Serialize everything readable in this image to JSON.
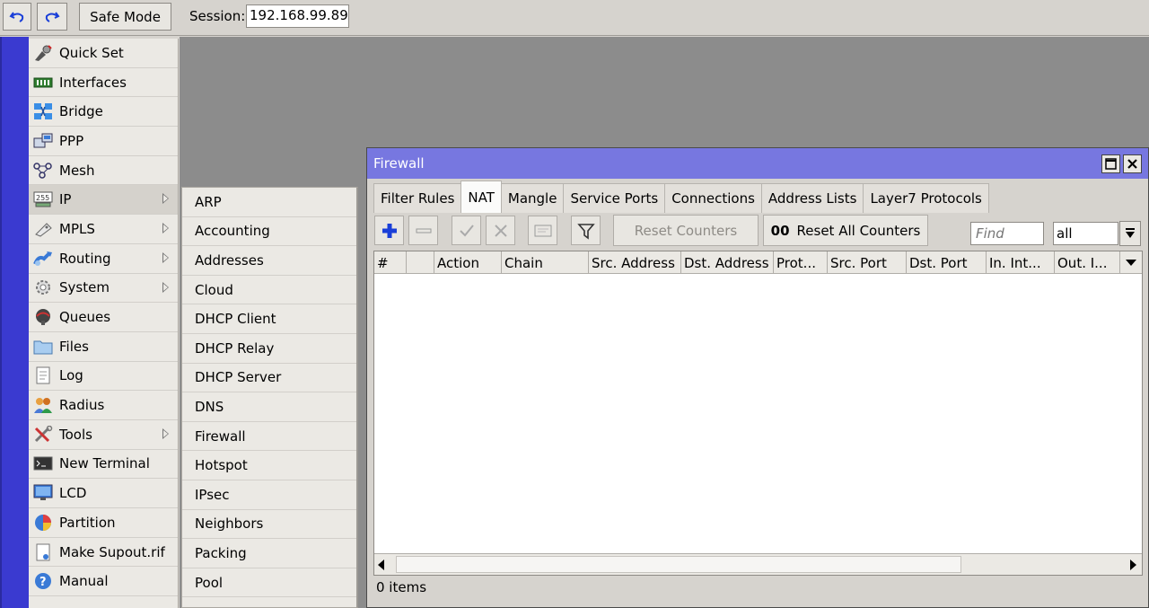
{
  "toolbar": {
    "safe_mode_label": "Safe Mode",
    "session_label": "Session:",
    "session_value": "192.168.99.89"
  },
  "main_menu": {
    "items": [
      {
        "label": "Quick Set",
        "icon": "quick-set-icon"
      },
      {
        "label": "Interfaces",
        "icon": "interfaces-icon"
      },
      {
        "label": "Bridge",
        "icon": "bridge-icon"
      },
      {
        "label": "PPP",
        "icon": "ppp-icon"
      },
      {
        "label": "Mesh",
        "icon": "mesh-icon"
      },
      {
        "label": "IP",
        "icon": "ip-icon"
      },
      {
        "label": "MPLS",
        "icon": "mpls-icon"
      },
      {
        "label": "Routing",
        "icon": "routing-icon"
      },
      {
        "label": "System",
        "icon": "system-icon"
      },
      {
        "label": "Queues",
        "icon": "queues-icon"
      },
      {
        "label": "Files",
        "icon": "files-icon"
      },
      {
        "label": "Log",
        "icon": "log-icon"
      },
      {
        "label": "Radius",
        "icon": "radius-icon"
      },
      {
        "label": "Tools",
        "icon": "tools-icon"
      },
      {
        "label": "New Terminal",
        "icon": "terminal-icon"
      },
      {
        "label": "LCD",
        "icon": "lcd-icon"
      },
      {
        "label": "Partition",
        "icon": "partition-icon"
      },
      {
        "label": "Make Supout.rif",
        "icon": "supout-icon"
      },
      {
        "label": "Manual",
        "icon": "manual-icon"
      }
    ]
  },
  "ip_submenu": {
    "items": [
      "ARP",
      "Accounting",
      "Addresses",
      "Cloud",
      "DHCP Client",
      "DHCP Relay",
      "DHCP Server",
      "DNS",
      "Firewall",
      "Hotspot",
      "IPsec",
      "Neighbors",
      "Packing",
      "Pool"
    ]
  },
  "firewall": {
    "title": "Firewall",
    "tabs": [
      "Filter Rules",
      "NAT",
      "Mangle",
      "Service Ports",
      "Connections",
      "Address Lists",
      "Layer7 Protocols"
    ],
    "active_tab": "NAT",
    "reset_counters_label": "Reset Counters",
    "reset_all_counters_prefix": "00",
    "reset_all_counters_label": "Reset All Counters",
    "find_placeholder": "Find",
    "filter_value": "all",
    "columns": [
      "#",
      "",
      "Action",
      "Chain",
      "Src. Address",
      "Dst. Address",
      "Prot...",
      "Src. Port",
      "Dst. Port",
      "In. Int...",
      "Out. I..."
    ],
    "status": "0 items"
  },
  "colors": {
    "title_bar": "#7777e0",
    "side_band": "#3a3ad0",
    "workspace": "#8c8c8c",
    "add_icon": "#1a3fd8"
  }
}
